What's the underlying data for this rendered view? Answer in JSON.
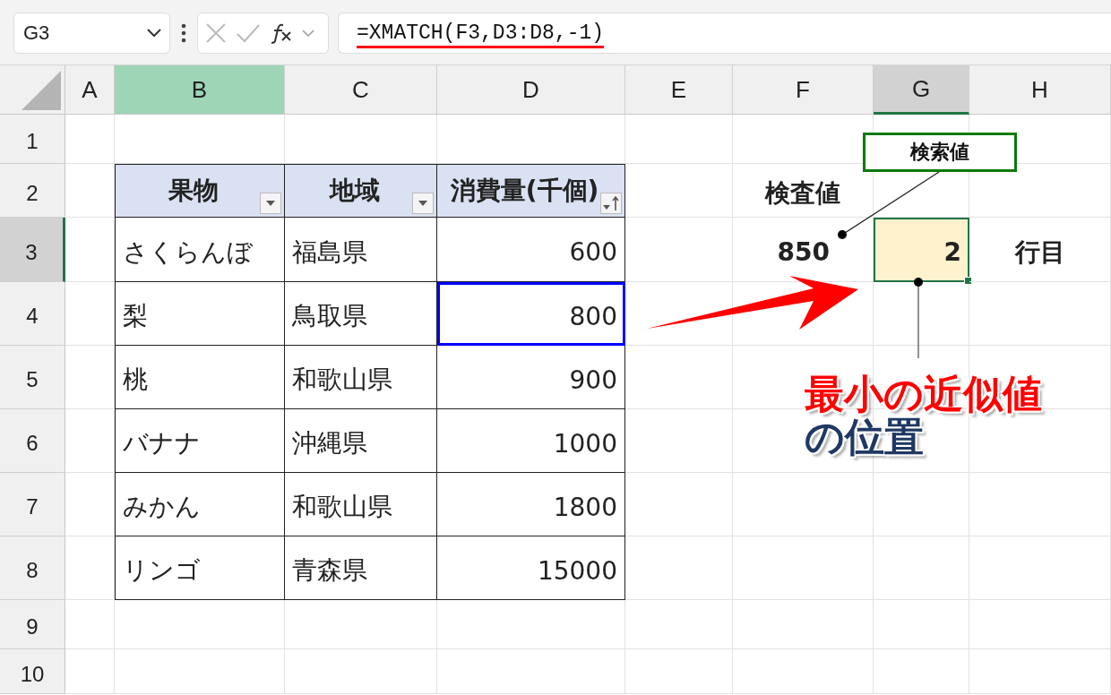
{
  "name_box": {
    "value": "G3"
  },
  "formula_bar": {
    "formula": "=XMATCH(F3,D3:D8,-1)"
  },
  "columns": [
    {
      "label": "A",
      "selected": false,
      "highlighted": false
    },
    {
      "label": "B",
      "selected": false,
      "highlighted": true
    },
    {
      "label": "C",
      "selected": false,
      "highlighted": false
    },
    {
      "label": "D",
      "selected": false,
      "highlighted": false
    },
    {
      "label": "E",
      "selected": false,
      "highlighted": false
    },
    {
      "label": "F",
      "selected": false,
      "highlighted": false
    },
    {
      "label": "G",
      "selected": true,
      "highlighted": false
    },
    {
      "label": "H",
      "selected": false,
      "highlighted": false
    }
  ],
  "rows": [
    {
      "label": "1",
      "selected": false
    },
    {
      "label": "2",
      "selected": false
    },
    {
      "label": "3",
      "selected": true
    },
    {
      "label": "4",
      "selected": false
    },
    {
      "label": "5",
      "selected": false
    },
    {
      "label": "6",
      "selected": false
    },
    {
      "label": "7",
      "selected": false
    },
    {
      "label": "8",
      "selected": false
    },
    {
      "label": "9",
      "selected": false
    },
    {
      "label": "10",
      "selected": false
    }
  ],
  "table": {
    "headers": [
      {
        "label": "果物",
        "sorted": false
      },
      {
        "label": "地域",
        "sorted": false
      },
      {
        "label": "消費量(千個)",
        "sorted": true
      }
    ],
    "rows": [
      {
        "fruit": "さくらんぼ",
        "region": "福島県",
        "consumption": "600",
        "outlined": false
      },
      {
        "fruit": "梨",
        "region": "鳥取県",
        "consumption": "800",
        "outlined": true
      },
      {
        "fruit": "桃",
        "region": "和歌山県",
        "consumption": "900",
        "outlined": false
      },
      {
        "fruit": "バナナ",
        "region": "沖縄県",
        "consumption": "1000",
        "outlined": false
      },
      {
        "fruit": "みかん",
        "region": "和歌山県",
        "consumption": "1800",
        "outlined": false
      },
      {
        "fruit": "リンゴ",
        "region": "青森県",
        "consumption": "15000",
        "outlined": false
      }
    ]
  },
  "lookup": {
    "label": "検査値",
    "value": "850",
    "result": "2",
    "result_suffix": "行目"
  },
  "callout": {
    "text": "検索値"
  },
  "note": {
    "lines": [
      {
        "text": "最小の近似値",
        "color": "#ff0000"
      },
      {
        "text": "の位置",
        "color": "#1f3864"
      }
    ]
  }
}
